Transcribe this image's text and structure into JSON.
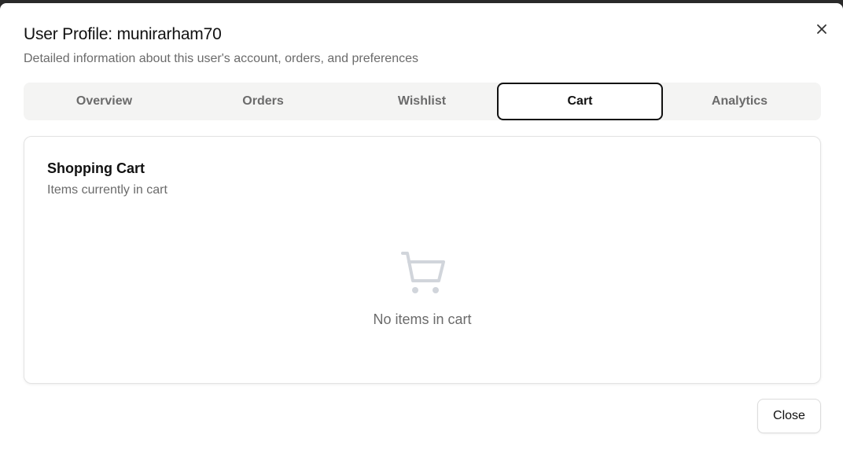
{
  "dialog": {
    "title": "User Profile: munirarham70",
    "subtitle": "Detailed information about this user's account, orders, and preferences",
    "close_icon": "close-icon",
    "close_button_label": "Close"
  },
  "tabs": [
    {
      "label": "Overview",
      "active": false
    },
    {
      "label": "Orders",
      "active": false
    },
    {
      "label": "Wishlist",
      "active": false
    },
    {
      "label": "Cart",
      "active": true
    },
    {
      "label": "Analytics",
      "active": false
    }
  ],
  "cart": {
    "title": "Shopping Cart",
    "subtitle": "Items currently in cart",
    "empty_icon": "shopping-cart-icon",
    "empty_message": "No items in cart"
  },
  "colors": {
    "tab_bar_bg": "#f4f4f3",
    "muted_text": "#6b6b6b",
    "icon_gray": "#d1d5db"
  }
}
